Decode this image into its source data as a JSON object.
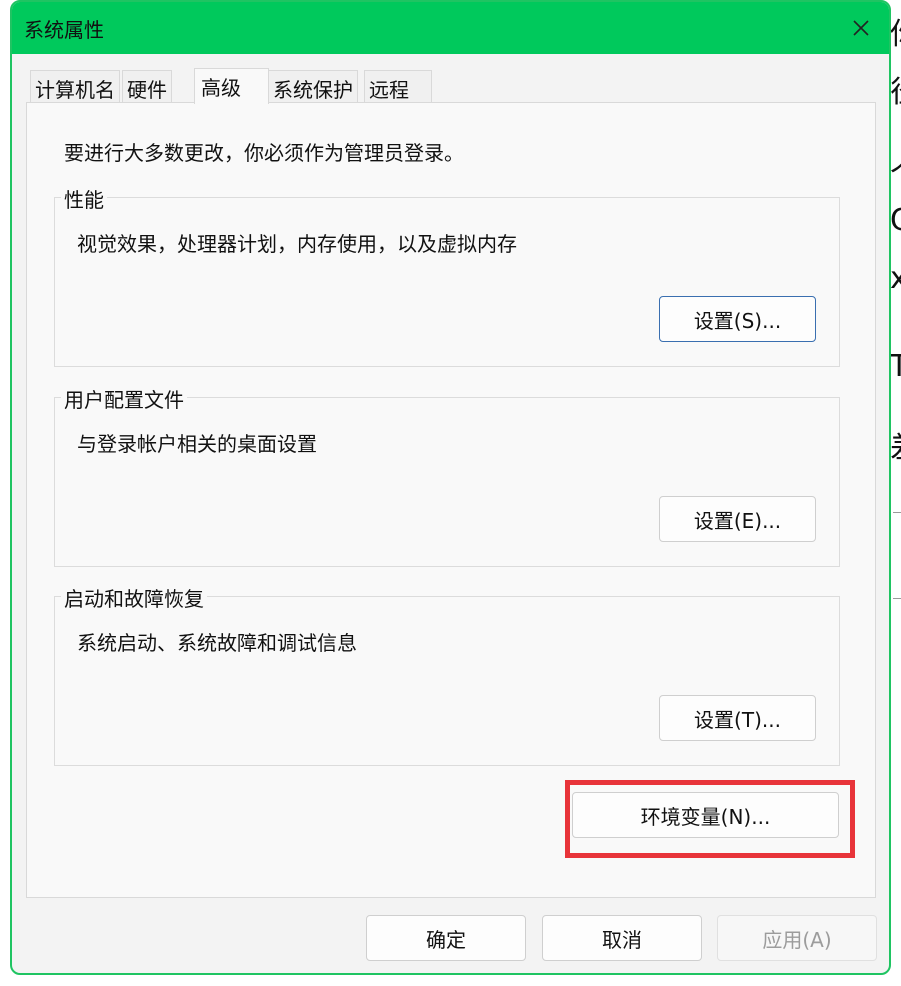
{
  "window": {
    "title": "系统属性",
    "accent_color": "#00c95c",
    "close_icon": "close-icon"
  },
  "tabs": [
    {
      "label": "计算机名",
      "active": false
    },
    {
      "label": "硬件",
      "active": false
    },
    {
      "label": "高级",
      "active": true
    },
    {
      "label": "系统保护",
      "active": false
    },
    {
      "label": "远程",
      "active": false
    }
  ],
  "advanced": {
    "admin_note": "要进行大多数更改，你必须作为管理员登录。",
    "performance": {
      "title": "性能",
      "description": "视觉效果，处理器计划，内存使用，以及虚拟内存",
      "button": "设置(S)..."
    },
    "user_profiles": {
      "title": "用户配置文件",
      "description": "与登录帐户相关的桌面设置",
      "button": "设置(E)..."
    },
    "startup_recovery": {
      "title": "启动和故障恢复",
      "description": "系统启动、系统故障和调试信息",
      "button": "设置(T)..."
    },
    "env_button": "环境变量(N)...",
    "highlight_color": "#e8343a"
  },
  "footer": {
    "ok": "确定",
    "cancel": "取消",
    "apply": "应用(A)",
    "apply_disabled": true
  },
  "background_glyphs": [
    "你",
    "径",
    "个",
    "C",
    "x",
    "T",
    "差"
  ]
}
